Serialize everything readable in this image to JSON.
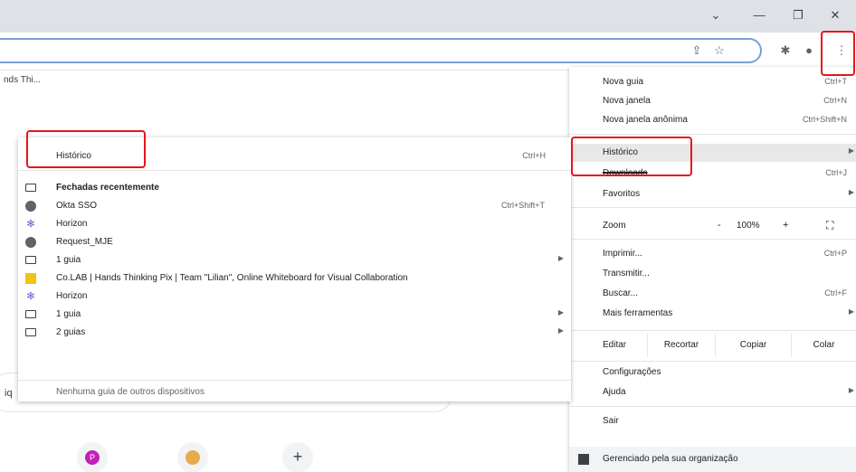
{
  "window_controls": {
    "tab_search_icon": "chevron-down",
    "minimize_icon": "minimize",
    "restore_icon": "restore",
    "close_icon": "close"
  },
  "bookmarks_bar": {
    "item_text": "nds Thi..."
  },
  "main_menu": {
    "new_tab": {
      "label": "Nova guia",
      "shortcut": "Ctrl+T"
    },
    "new_window": {
      "label": "Nova janela",
      "shortcut": "Ctrl+N"
    },
    "incognito": {
      "label": "Nova janela anônima",
      "shortcut": "Ctrl+Shift+N"
    },
    "history": {
      "label": "Histórico"
    },
    "downloads": {
      "label": "Downloads",
      "shortcut": "Ctrl+J"
    },
    "favorites": {
      "label": "Favoritos"
    },
    "zoom": {
      "label": "Zoom",
      "minus": "-",
      "value": "100%",
      "plus": "+"
    },
    "print": {
      "label": "Imprimir...",
      "shortcut": "Ctrl+P"
    },
    "cast": {
      "label": "Transmitir..."
    },
    "find": {
      "label": "Buscar...",
      "shortcut": "Ctrl+F"
    },
    "more_tools": {
      "label": "Mais ferramentas"
    },
    "edit": {
      "label": "Editar",
      "cut": "Recortar",
      "copy": "Copiar",
      "paste": "Colar"
    },
    "settings": {
      "label": "Configurações"
    },
    "help": {
      "label": "Ajuda"
    },
    "exit": {
      "label": "Sair"
    },
    "managed": {
      "label": "Gerenciado pela sua organização"
    }
  },
  "history_menu": {
    "header": {
      "label": "Histórico",
      "shortcut": "Ctrl+H"
    },
    "recently_closed": "Fechadas recentemente",
    "items": [
      {
        "label": "Okta SSO",
        "shortcut": "Ctrl+Shift+T",
        "icon": "globe-icon"
      },
      {
        "label": "Horizon",
        "icon": "horizon-icon"
      },
      {
        "label": "Request_MJE",
        "icon": "globe-icon"
      },
      {
        "label": "1 guia",
        "icon": "tab-icon",
        "submenu": true
      },
      {
        "label": "Co.LAB | Hands Thinking Pix | Team \"Lilian\", Online Whiteboard for Visual Collaboration",
        "icon": "colab-icon"
      },
      {
        "label": "Horizon",
        "icon": "horizon-icon"
      },
      {
        "label": "1 guia",
        "icon": "tab-icon",
        "submenu": true
      },
      {
        "label": "2 guias",
        "icon": "tab-icon",
        "submenu": true
      }
    ],
    "other_devices": "Nenhuma guia de outros dispositivos"
  },
  "page": {
    "card_text": "iq",
    "shortcut_letter": "P"
  },
  "colors": {
    "annotation": "#e8141a",
    "highlight": "#e8e8e8",
    "titlebar": "#dee1e6",
    "omnibox_border": "#7a9fd6"
  }
}
